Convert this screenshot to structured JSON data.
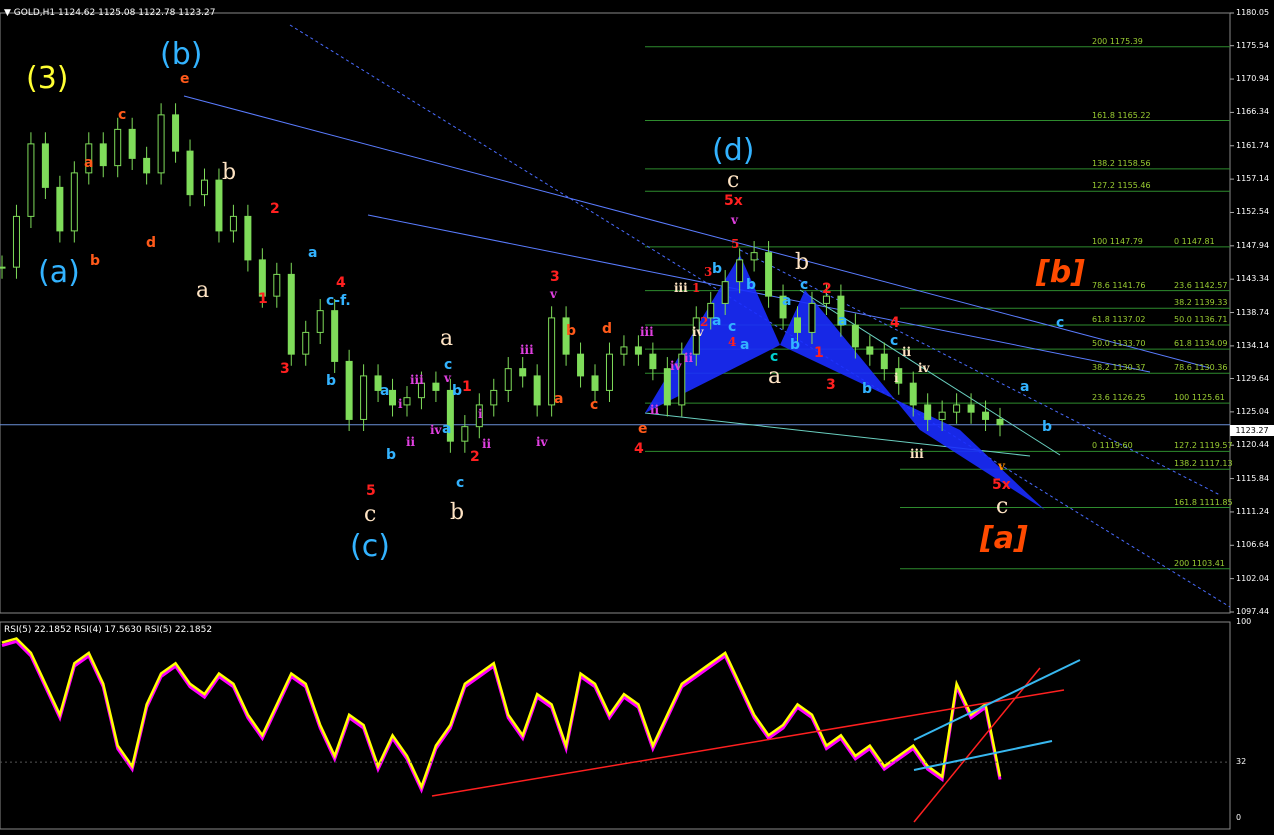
{
  "header": {
    "symbol": "GOLD,H1",
    "ohlc": "1124.62 1125.08 1122.78 1123.27",
    "indicator_legend": "RSI(5) 22.1852  RSI(4) 17.5630  RSI(5) 22.1852",
    "current_price": "1123.27"
  },
  "colors": {
    "background": "#000000",
    "candles": "#7fdc5a",
    "fib": "#2e8b2e",
    "trend_blue": "#5a7cff",
    "harmonic_fill": "#1a2cff",
    "rsi_main": "#ffff00",
    "rsi_shadow": "#ff00ff",
    "rsi_trend_red": "#ff2020",
    "rsi_trend_cyan": "#38b8f0"
  },
  "chart_data": [
    {
      "type": "candlestick",
      "title": "",
      "ylim": [
        1097.44,
        1180.05
      ],
      "y_ticks": [
        "1180.05",
        "1175.54",
        "1170.94",
        "1166.34",
        "1161.74",
        "1157.14",
        "1152.54",
        "1147.94",
        "1143.34",
        "1138.74",
        "1134.14",
        "1129.64",
        "1125.04",
        "1120.44",
        "1115.84",
        "1111.24",
        "1106.64",
        "1102.04",
        "1097.44"
      ],
      "approx_close_path": [
        1145,
        1152,
        1162,
        1156,
        1150,
        1158,
        1162,
        1159,
        1164,
        1160,
        1158,
        1166,
        1161,
        1155,
        1157,
        1150,
        1152,
        1146,
        1141,
        1144,
        1133,
        1136,
        1139,
        1132,
        1124,
        1130,
        1128,
        1126,
        1127,
        1129,
        1128,
        1121,
        1123,
        1126,
        1128,
        1131,
        1130,
        1126,
        1138,
        1133,
        1130,
        1128,
        1133,
        1134,
        1133,
        1131,
        1126,
        1133,
        1138,
        1140,
        1143,
        1146,
        1147,
        1141,
        1138,
        1136,
        1140,
        1141,
        1137,
        1134,
        1133,
        1131,
        1129,
        1126,
        1124,
        1125,
        1126,
        1125,
        1124,
        1123.27
      ],
      "fib_levels": [
        {
          "left": "200",
          "lval": "1175.39",
          "right": "",
          "rval": ""
        },
        {
          "left": "161.8",
          "lval": "1165.22",
          "right": "",
          "rval": ""
        },
        {
          "left": "138.2",
          "lval": "1158.56",
          "right": "",
          "rval": ""
        },
        {
          "left": "127.2",
          "lval": "1155.46",
          "right": "",
          "rval": ""
        },
        {
          "left": "100",
          "lval": "1147.79",
          "right": "0",
          "rval": "1147.81"
        },
        {
          "left": "78.6",
          "lval": "1141.76",
          "right": "23.6",
          "rval": "1142.57"
        },
        {
          "left": "",
          "lval": "",
          "right": "38.2",
          "rval": "1139.33"
        },
        {
          "left": "61.8",
          "lval": "1137.02",
          "right": "50.0",
          "rval": "1136.71"
        },
        {
          "left": "50.0",
          "lval": "1133.70",
          "right": "61.8",
          "rval": "1134.09"
        },
        {
          "left": "38.2",
          "lval": "1130.37",
          "right": "78.6",
          "rval": "1130.36"
        },
        {
          "left": "23.6",
          "lval": "1126.25",
          "right": "100",
          "rval": "1125.61"
        },
        {
          "left": "0",
          "lval": "1119.60",
          "right": "127.2",
          "rval": "1119.57"
        },
        {
          "left": "",
          "lval": "",
          "right": "138.2",
          "rval": "1117.13"
        },
        {
          "left": "",
          "lval": "",
          "right": "161.8",
          "rval": "1111.85"
        },
        {
          "left": "",
          "lval": "",
          "right": "200",
          "rval": "1103.41"
        }
      ]
    },
    {
      "type": "line",
      "title": "",
      "ylim": [
        0,
        100
      ],
      "y_ticks": [
        "100",
        "32",
        "0"
      ],
      "series": [
        {
          "name": "RSI(5)",
          "values": [
            90,
            92,
            85,
            70,
            55,
            80,
            85,
            70,
            40,
            30,
            60,
            75,
            80,
            70,
            65,
            75,
            70,
            55,
            45,
            60,
            75,
            70,
            50,
            35,
            55,
            50,
            30,
            45,
            35,
            20,
            40,
            50,
            70,
            75,
            80,
            55,
            45,
            65,
            60,
            40,
            75,
            70,
            55,
            65,
            60,
            40,
            55,
            70,
            75,
            80,
            85,
            70,
            55,
            45,
            50,
            60,
            55,
            40,
            45,
            35,
            40,
            30,
            35,
            40,
            30,
            25,
            70,
            55,
            60,
            25
          ]
        }
      ]
    }
  ],
  "wave_labels": {
    "w3": "(3)",
    "wb": "(b)",
    "wa": "(a)",
    "wc": "(c)",
    "wd": "(d)",
    "e": "e",
    "c": "c",
    "a": "a",
    "d": "d",
    "b": "b",
    "n1": "1",
    "n2": "2",
    "n3": "3",
    "n4": "4",
    "n5": "5",
    "cf": "c-f.",
    "i": "i",
    "ii": "ii",
    "iii": "iii",
    "iv": "iv",
    "v": "v",
    "n5x": "5x",
    "bb": "[b]",
    "ba": "[a]"
  }
}
